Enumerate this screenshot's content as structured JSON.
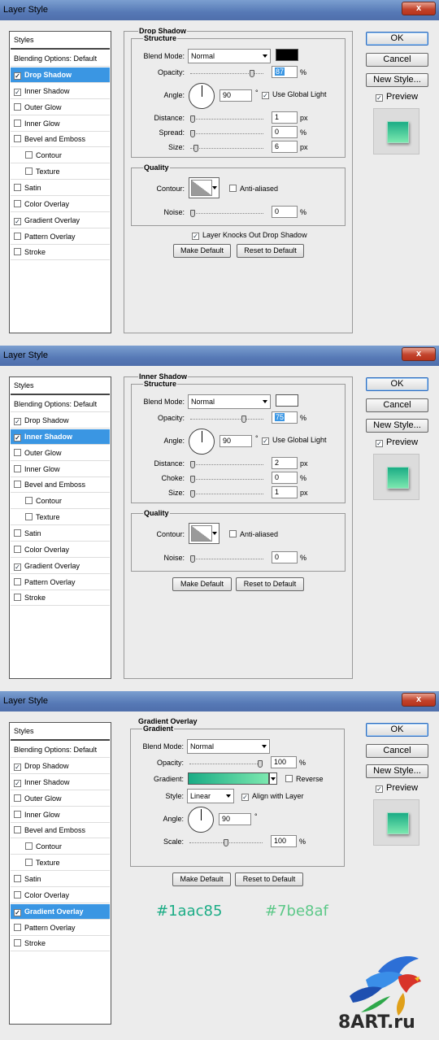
{
  "colors": {
    "gradient_start": "#1aac85",
    "gradient_end": "#7be8af"
  },
  "dialogs": [
    {
      "title": "Layer Style",
      "close_label": "x",
      "styles_header": "Styles",
      "blending_label": "Blending Options: Default",
      "style_items": [
        {
          "label": "Drop Shadow",
          "checked": true,
          "selected": true
        },
        {
          "label": "Inner Shadow",
          "checked": true
        },
        {
          "label": "Outer Glow",
          "checked": false
        },
        {
          "label": "Inner Glow",
          "checked": false
        },
        {
          "label": "Bevel and Emboss",
          "checked": false
        },
        {
          "label": "Contour",
          "checked": false,
          "sub": true
        },
        {
          "label": "Texture",
          "checked": false,
          "sub": true
        },
        {
          "label": "Satin",
          "checked": false
        },
        {
          "label": "Color Overlay",
          "checked": false
        },
        {
          "label": "Gradient Overlay",
          "checked": true
        },
        {
          "label": "Pattern Overlay",
          "checked": false
        },
        {
          "label": "Stroke",
          "checked": false
        }
      ],
      "ok": "OK",
      "cancel": "Cancel",
      "new_style": "New Style...",
      "preview": "Preview",
      "panel_title": "Drop Shadow",
      "structure_title": "Structure",
      "blend_mode_label": "Blend Mode:",
      "blend_mode": "Normal",
      "color": "#000000",
      "opacity_label": "Opacity:",
      "opacity": "87",
      "opacity_fraction": 0.87,
      "angle_label": "Angle:",
      "angle": "90",
      "degree": "°",
      "global_light": "Use Global Light",
      "distance_label": "Distance:",
      "distance": "1",
      "spread_label": "Spread:",
      "spread": "0",
      "size_label": "Size:",
      "size": "6",
      "px": "px",
      "pct": "%",
      "quality_title": "Quality",
      "contour_label": "Contour:",
      "anti_aliased": "Anti-aliased",
      "noise_label": "Noise:",
      "noise": "0",
      "knocks_out": "Layer Knocks Out Drop Shadow",
      "make_default": "Make Default",
      "reset_default": "Reset to Default"
    },
    {
      "title": "Layer Style",
      "close_label": "x",
      "styles_header": "Styles",
      "blending_label": "Blending Options: Default",
      "style_items": [
        {
          "label": "Drop Shadow",
          "checked": true
        },
        {
          "label": "Inner Shadow",
          "checked": true,
          "selected": true
        },
        {
          "label": "Outer Glow",
          "checked": false
        },
        {
          "label": "Inner Glow",
          "checked": false
        },
        {
          "label": "Bevel and Emboss",
          "checked": false
        },
        {
          "label": "Contour",
          "checked": false,
          "sub": true
        },
        {
          "label": "Texture",
          "checked": false,
          "sub": true
        },
        {
          "label": "Satin",
          "checked": false
        },
        {
          "label": "Color Overlay",
          "checked": false
        },
        {
          "label": "Gradient Overlay",
          "checked": true
        },
        {
          "label": "Pattern Overlay",
          "checked": false
        },
        {
          "label": "Stroke",
          "checked": false
        }
      ],
      "ok": "OK",
      "cancel": "Cancel",
      "new_style": "New Style...",
      "preview": "Preview",
      "panel_title": "Inner Shadow",
      "structure_title": "Structure",
      "blend_mode_label": "Blend Mode:",
      "blend_mode": "Normal",
      "color": "#ffffff",
      "opacity_label": "Opacity:",
      "opacity": "75",
      "opacity_fraction": 0.75,
      "angle_label": "Angle:",
      "angle": "90",
      "degree": "°",
      "global_light": "Use Global Light",
      "distance_label": "Distance:",
      "distance": "2",
      "choke_label": "Choke:",
      "choke": "0",
      "size_label": "Size:",
      "size": "1",
      "px": "px",
      "pct": "%",
      "quality_title": "Quality",
      "contour_label": "Contour:",
      "anti_aliased": "Anti-aliased",
      "noise_label": "Noise:",
      "noise": "0",
      "make_default": "Make Default",
      "reset_default": "Reset to Default"
    },
    {
      "title": "Layer Style",
      "close_label": "x",
      "styles_header": "Styles",
      "blending_label": "Blending Options: Default",
      "style_items": [
        {
          "label": "Drop Shadow",
          "checked": true
        },
        {
          "label": "Inner Shadow",
          "checked": true
        },
        {
          "label": "Outer Glow",
          "checked": false
        },
        {
          "label": "Inner Glow",
          "checked": false
        },
        {
          "label": "Bevel and Emboss",
          "checked": false
        },
        {
          "label": "Contour",
          "checked": false,
          "sub": true
        },
        {
          "label": "Texture",
          "checked": false,
          "sub": true
        },
        {
          "label": "Satin",
          "checked": false
        },
        {
          "label": "Color Overlay",
          "checked": false
        },
        {
          "label": "Gradient Overlay",
          "checked": true,
          "selected": true
        },
        {
          "label": "Pattern Overlay",
          "checked": false
        },
        {
          "label": "Stroke",
          "checked": false
        }
      ],
      "ok": "OK",
      "cancel": "Cancel",
      "new_style": "New Style...",
      "preview": "Preview",
      "panel_title": "Gradient Overlay",
      "gradient_title": "Gradient",
      "blend_mode_label": "Blend Mode:",
      "blend_mode": "Normal",
      "opacity_label": "Opacity:",
      "opacity": "100",
      "opacity_fraction": 1.0,
      "gradient_label": "Gradient:",
      "reverse": "Reverse",
      "style_label": "Style:",
      "style": "Linear",
      "align_layer": "Align with Layer",
      "angle_label": "Angle:",
      "angle": "90",
      "degree": "°",
      "scale_label": "Scale:",
      "scale": "100",
      "scale_fraction": 0.5,
      "pct": "%",
      "make_default": "Make Default",
      "reset_default": "Reset to Default",
      "hex_start": "#1aac85",
      "hex_end": "#7be8af"
    }
  ],
  "watermark": {
    "site_text": "8ART.ru"
  }
}
